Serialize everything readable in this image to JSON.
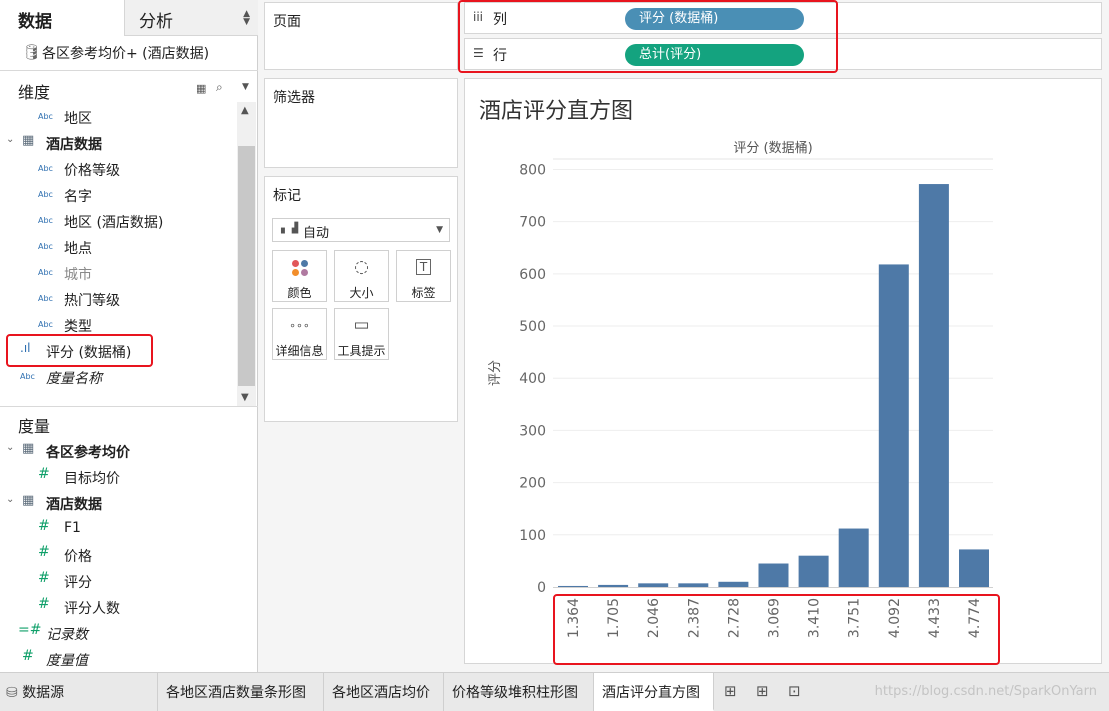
{
  "left_pane": {
    "tabs": {
      "data": "数据",
      "analysis": "分析"
    },
    "datasource": "各区参考均价+ (酒店数据)",
    "dimensions_title": "维度",
    "measures_title": "度量",
    "dimensions": [
      {
        "type": "Abc",
        "label": "地区"
      },
      {
        "type": "grid",
        "label": "酒店数据",
        "group": true
      },
      {
        "type": "Abc",
        "label": "价格等级"
      },
      {
        "type": "Abc",
        "label": "名字"
      },
      {
        "type": "Abc",
        "label": "地区 (酒店数据)"
      },
      {
        "type": "Abc",
        "label": "地点"
      },
      {
        "type": "Abc",
        "label": "城市"
      },
      {
        "type": "Abc",
        "label": "热门等级"
      },
      {
        "type": "Abc",
        "label": "类型"
      },
      {
        "type": "hist",
        "label": "评分 (数据桶)"
      },
      {
        "type": "Abc",
        "label": "度量名称"
      }
    ],
    "measures": [
      {
        "type": "grid",
        "label": "各区参考均价",
        "group": true
      },
      {
        "type": "#",
        "label": "目标均价"
      },
      {
        "type": "grid",
        "label": "酒店数据",
        "group": true
      },
      {
        "type": "#",
        "label": "F1"
      },
      {
        "type": "#",
        "label": "价格"
      },
      {
        "type": "#",
        "label": "评分"
      },
      {
        "type": "#",
        "label": "评分人数"
      },
      {
        "type": "=#",
        "label": "记录数"
      },
      {
        "type": "#",
        "label": "度量值"
      }
    ]
  },
  "cards": {
    "pages": "页面",
    "filters": "筛选器",
    "marks": "标记",
    "marks_type": "自动",
    "mark_buttons": [
      "颜色",
      "大小",
      "标签",
      "详细信息",
      "工具提示"
    ]
  },
  "shelves": {
    "columns_label": "列",
    "rows_label": "行",
    "columns_pill": "评分 (数据桶)",
    "rows_pill": "总计(评分)",
    "columns_pill_color": "#4a8fb5",
    "rows_pill_color": "#14a37f"
  },
  "view": {
    "title": "酒店评分直方图"
  },
  "chart_data": {
    "type": "bar",
    "title": "",
    "xlabel": "评分 (数据桶)",
    "ylabel": "评分",
    "categories": [
      "1.364",
      "1.705",
      "2.046",
      "2.387",
      "2.728",
      "3.069",
      "3.410",
      "3.751",
      "4.092",
      "4.433",
      "4.774"
    ],
    "values": [
      2,
      4,
      7,
      7,
      10,
      45,
      60,
      112,
      618,
      772,
      72
    ],
    "yticks": [
      0,
      100,
      200,
      300,
      400,
      500,
      600,
      700,
      800
    ],
    "ylim": [
      0,
      820
    ],
    "bar_color": "#4e79a7",
    "grid": true
  },
  "bottom_tabs": {
    "datasource": "数据源",
    "sheets": [
      "各地区酒店数量条形图",
      "各地区酒店均价",
      "价格等级堆积柱形图",
      "酒店评分直方图"
    ],
    "active": "酒店评分直方图",
    "watermark": "https://blog.csdn.net/SparkOnYarn"
  }
}
